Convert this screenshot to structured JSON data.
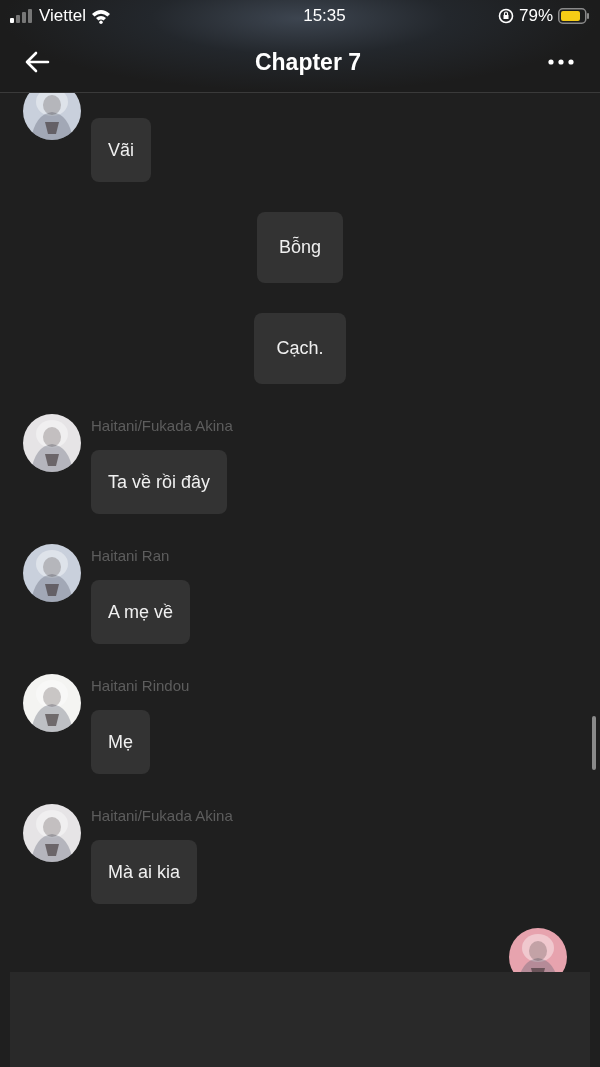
{
  "status_bar": {
    "carrier": "Viettel",
    "time": "15:35",
    "battery": "79%"
  },
  "header": {
    "title": "Chapter 7"
  },
  "messages": [
    {
      "kind": "character",
      "color": "#c9d0dc",
      "text": "Vãi"
    },
    {
      "kind": "narration",
      "text": "Bỗng"
    },
    {
      "kind": "narration",
      "text": "Cạch."
    },
    {
      "kind": "character",
      "color": "#e6e4e6",
      "name": "Haitani/Fukada Akina",
      "text": "Ta về rồi đây"
    },
    {
      "kind": "character",
      "color": "#c9d0dc",
      "name": "Haitani Ran",
      "text": "A mẹ về"
    },
    {
      "kind": "character",
      "color": "#f4f4f2",
      "name": "Haitani Rindou",
      "text": "Mẹ"
    },
    {
      "kind": "character",
      "color": "#e6e4e6",
      "name": "Haitani/Fukada Akina",
      "text": "Mà ai kia"
    },
    {
      "kind": "self_partial",
      "color": "#e7a3ae"
    }
  ]
}
